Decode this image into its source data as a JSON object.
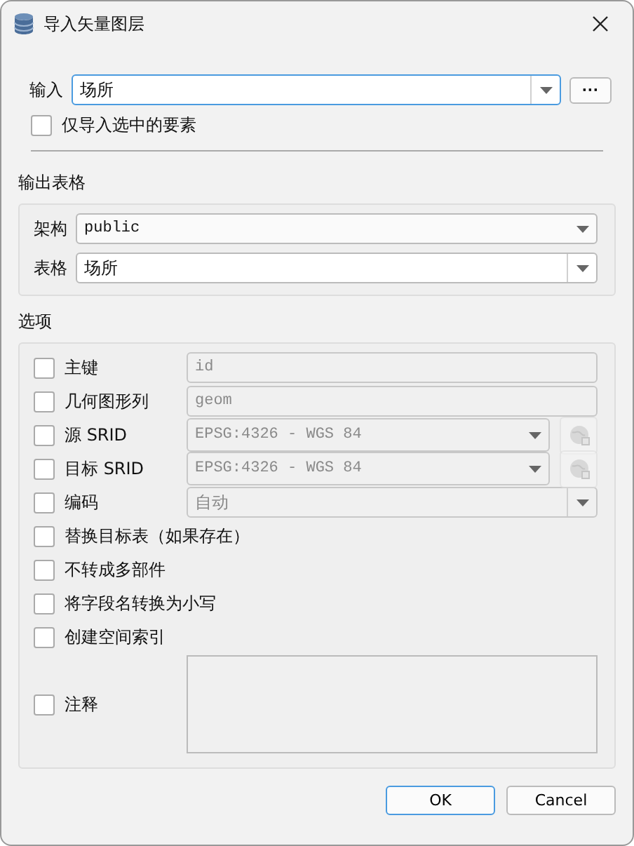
{
  "window": {
    "title": "导入矢量图层"
  },
  "input": {
    "label": "输入",
    "value": "场所",
    "browse_button": "···"
  },
  "only_selected": {
    "label": "仅导入选中的要素",
    "checked": false
  },
  "output_table": {
    "title": "输出表格",
    "schema": {
      "label": "架构",
      "value": "public"
    },
    "table": {
      "label": "表格",
      "value": "场所"
    }
  },
  "options": {
    "title": "选项",
    "items": [
      {
        "kind": "text",
        "label": "主键",
        "checked": false,
        "value": "id",
        "disabled": true
      },
      {
        "kind": "text",
        "label": "几何图形列",
        "checked": false,
        "value": "geom",
        "disabled": true
      },
      {
        "kind": "crs",
        "label": "源 SRID",
        "checked": false,
        "value": "EPSG:4326 - WGS 84",
        "disabled": true
      },
      {
        "kind": "crs",
        "label": "目标 SRID",
        "checked": false,
        "value": "EPSG:4326 - WGS 84",
        "disabled": true
      },
      {
        "kind": "combo",
        "label": "编码",
        "checked": false,
        "value": "自动",
        "disabled": true
      },
      {
        "kind": "check",
        "label": "替换目标表（如果存在）",
        "checked": false
      },
      {
        "kind": "check",
        "label": "不转成多部件",
        "checked": false
      },
      {
        "kind": "check",
        "label": "将字段名转换为小写",
        "checked": false
      },
      {
        "kind": "check",
        "label": "创建空间索引",
        "checked": false
      },
      {
        "kind": "memo",
        "label": "注释",
        "checked": false,
        "disabled": true
      }
    ]
  },
  "buttons": [
    {
      "label": "OK",
      "default": true
    },
    {
      "label": "Cancel",
      "default": false
    }
  ]
}
